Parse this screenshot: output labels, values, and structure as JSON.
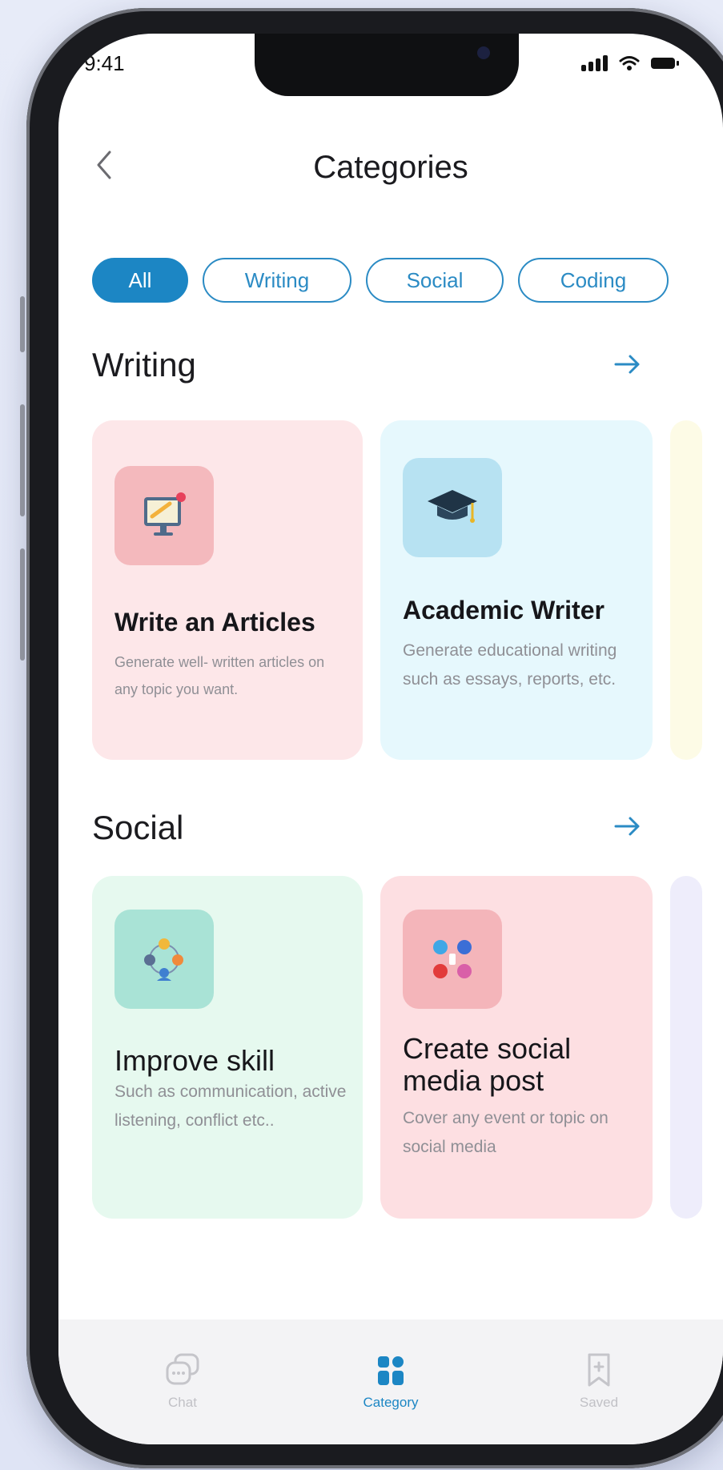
{
  "status_bar": {
    "time": "9:41"
  },
  "header": {
    "title": "Categories"
  },
  "filter_chips": [
    {
      "label": "All",
      "active": true
    },
    {
      "label": "Writing",
      "active": false
    },
    {
      "label": "Social",
      "active": false
    },
    {
      "label": "Coding",
      "active": false
    }
  ],
  "sections": [
    {
      "title": "Writing",
      "cards": [
        {
          "title": "Write an Articles",
          "description": "Generate well- written articles on any topic you want.",
          "icon": "computer-writing-icon",
          "background": "#fde7e9",
          "icon_background": "#f4b9bd"
        },
        {
          "title": "Academic Writer",
          "description": "Generate educational writing such as essays, reports, etc.",
          "icon": "graduation-cap-icon",
          "background": "#e6f8fd",
          "icon_background": "#b7e2f2"
        }
      ]
    },
    {
      "title": "Social",
      "cards": [
        {
          "title": "Improve skill",
          "description": "Such as communication, active listening, conflict etc..",
          "icon": "team-network-icon",
          "background": "#e6f9ef",
          "icon_background": "#a9e3d6"
        },
        {
          "title": "Create social media post",
          "description": "Cover any event or topic on social media",
          "icon": "social-media-icon",
          "background": "#fddfe2",
          "icon_background": "#f4b5ba"
        }
      ]
    }
  ],
  "tab_bar": [
    {
      "label": "Chat",
      "icon": "chat-bubbles-icon",
      "active": false
    },
    {
      "label": "Category",
      "icon": "grid-category-icon",
      "active": true
    },
    {
      "label": "Saved",
      "icon": "bookmark-icon",
      "active": false
    }
  ],
  "colors": {
    "accent": "#1c86c4",
    "text_primary": "#1b1b1f",
    "text_secondary": "#8f8f95",
    "tab_inactive": "#b8b8bd"
  }
}
